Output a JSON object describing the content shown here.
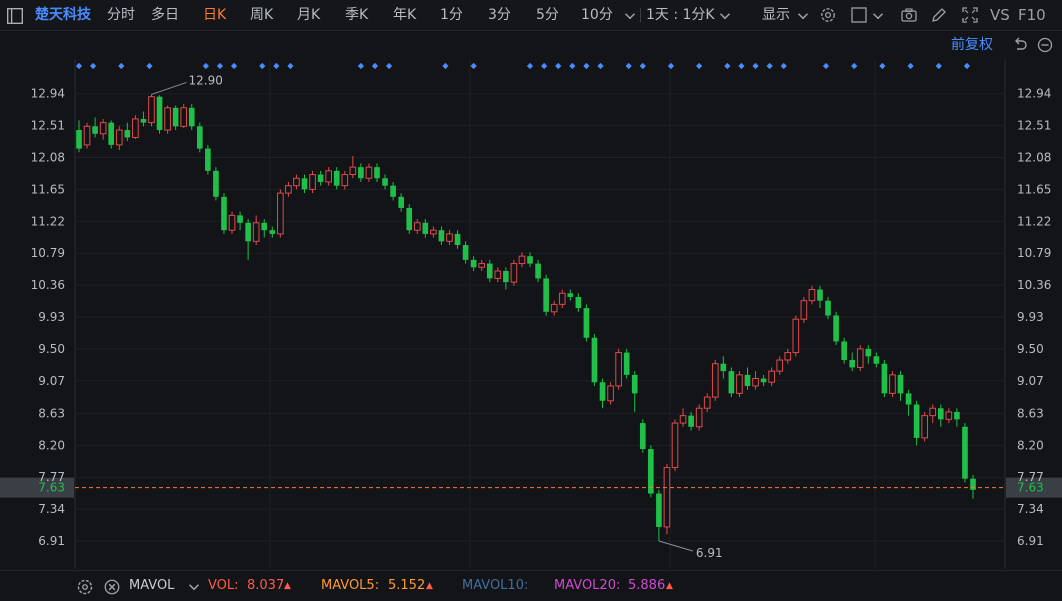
{
  "toolbar": {
    "stock_name": "楚天科技",
    "tabs": [
      {
        "label": "分时"
      },
      {
        "label": "多日"
      },
      {
        "label": "日K",
        "active": true
      },
      {
        "label": "周K"
      },
      {
        "label": "月K"
      },
      {
        "label": "季K"
      },
      {
        "label": "年K"
      },
      {
        "label": "1分"
      },
      {
        "label": "3分"
      },
      {
        "label": "5分"
      },
      {
        "label": "10分"
      }
    ],
    "period_select": "1天 : 1分K",
    "display_label": "显示",
    "vs_label": "VS",
    "f10_label": "F10"
  },
  "sub_toolbar": {
    "adjust_label": "前复权"
  },
  "chart_data": {
    "type": "candlestick",
    "y_ticks": [
      "12.94",
      "12.51",
      "12.08",
      "11.65",
      "11.22",
      "10.79",
      "10.36",
      "9.93",
      "9.50",
      "9.07",
      "8.63",
      "8.20",
      "7.77",
      "7.34",
      "6.91"
    ],
    "ylim": [
      6.6,
      13.3
    ],
    "current_price": "7.63",
    "high_label": "12.90",
    "low_label": "6.91",
    "candles": [
      [
        12.45,
        12.2,
        12.58,
        12.15
      ],
      [
        12.25,
        12.5,
        12.55,
        12.2
      ],
      [
        12.5,
        12.4,
        12.62,
        12.35
      ],
      [
        12.4,
        12.55,
        12.6,
        12.32
      ],
      [
        12.55,
        12.25,
        12.58,
        12.2
      ],
      [
        12.25,
        12.45,
        12.5,
        12.18
      ],
      [
        12.45,
        12.35,
        12.55,
        12.3
      ],
      [
        12.35,
        12.6,
        12.65,
        12.33
      ],
      [
        12.6,
        12.55,
        12.7,
        12.5
      ],
      [
        12.55,
        12.9,
        12.93,
        12.5
      ],
      [
        12.9,
        12.45,
        12.92,
        12.4
      ],
      [
        12.45,
        12.75,
        12.78,
        12.4
      ],
      [
        12.75,
        12.5,
        12.78,
        12.45
      ],
      [
        12.5,
        12.75,
        12.8,
        12.48
      ],
      [
        12.75,
        12.5,
        12.8,
        12.45
      ],
      [
        12.5,
        12.2,
        12.55,
        12.15
      ],
      [
        12.2,
        11.9,
        12.25,
        11.85
      ],
      [
        11.9,
        11.55,
        11.95,
        11.5
      ],
      [
        11.55,
        11.1,
        11.6,
        11.05
      ],
      [
        11.1,
        11.3,
        11.35,
        11.05
      ],
      [
        11.3,
        11.2,
        11.35,
        11.1
      ],
      [
        11.2,
        10.95,
        11.25,
        10.7
      ],
      [
        10.95,
        11.2,
        11.3,
        10.9
      ],
      [
        11.2,
        11.1,
        11.25,
        11.0
      ],
      [
        11.1,
        11.05,
        11.15,
        11.0
      ],
      [
        11.05,
        11.6,
        11.65,
        11.0
      ],
      [
        11.6,
        11.7,
        11.75,
        11.55
      ],
      [
        11.7,
        11.8,
        11.85,
        11.65
      ],
      [
        11.8,
        11.65,
        11.85,
        11.6
      ],
      [
        11.65,
        11.85,
        11.9,
        11.6
      ],
      [
        11.85,
        11.75,
        11.9,
        11.7
      ],
      [
        11.75,
        11.9,
        11.95,
        11.7
      ],
      [
        11.9,
        11.7,
        11.95,
        11.65
      ],
      [
        11.7,
        11.85,
        11.9,
        11.65
      ],
      [
        11.85,
        11.95,
        12.1,
        11.8
      ],
      [
        11.95,
        11.8,
        12.0,
        11.75
      ],
      [
        11.8,
        11.95,
        12.0,
        11.75
      ],
      [
        11.95,
        11.8,
        12.0,
        11.75
      ],
      [
        11.8,
        11.7,
        11.85,
        11.65
      ],
      [
        11.7,
        11.55,
        11.75,
        11.5
      ],
      [
        11.55,
        11.4,
        11.6,
        11.35
      ],
      [
        11.4,
        11.1,
        11.45,
        11.05
      ],
      [
        11.1,
        11.2,
        11.25,
        11.05
      ],
      [
        11.2,
        11.05,
        11.25,
        11.0
      ],
      [
        11.05,
        11.1,
        11.15,
        11.0
      ],
      [
        11.1,
        10.95,
        11.15,
        10.9
      ],
      [
        10.95,
        11.05,
        11.1,
        10.9
      ],
      [
        11.05,
        10.9,
        11.1,
        10.85
      ],
      [
        10.9,
        10.7,
        10.95,
        10.65
      ],
      [
        10.7,
        10.6,
        10.75,
        10.55
      ],
      [
        10.6,
        10.65,
        10.7,
        10.55
      ],
      [
        10.65,
        10.45,
        10.7,
        10.4
      ],
      [
        10.45,
        10.55,
        10.6,
        10.4
      ],
      [
        10.55,
        10.4,
        10.6,
        10.3
      ],
      [
        10.4,
        10.65,
        10.7,
        10.35
      ],
      [
        10.65,
        10.75,
        10.8,
        10.6
      ],
      [
        10.75,
        10.65,
        10.8,
        10.6
      ],
      [
        10.65,
        10.45,
        10.7,
        10.4
      ],
      [
        10.45,
        10.0,
        10.5,
        9.95
      ],
      [
        10.0,
        10.1,
        10.15,
        9.95
      ],
      [
        10.1,
        10.25,
        10.3,
        10.05
      ],
      [
        10.25,
        10.2,
        10.3,
        10.15
      ],
      [
        10.2,
        10.05,
        10.25,
        10.0
      ],
      [
        10.05,
        9.65,
        10.1,
        9.6
      ],
      [
        9.65,
        9.05,
        9.7,
        9.0
      ],
      [
        9.05,
        8.8,
        9.1,
        8.7
      ],
      [
        8.8,
        9.0,
        9.05,
        8.75
      ],
      [
        9.0,
        9.45,
        9.5,
        8.95
      ],
      [
        9.45,
        9.15,
        9.5,
        9.1
      ],
      [
        9.15,
        8.9,
        9.2,
        8.65
      ],
      [
        8.5,
        8.15,
        8.55,
        8.1
      ],
      [
        8.15,
        7.55,
        8.2,
        7.5
      ],
      [
        7.55,
        7.1,
        7.6,
        6.91
      ],
      [
        7.1,
        7.9,
        7.95,
        7.0
      ],
      [
        7.9,
        8.5,
        8.55,
        7.85
      ],
      [
        8.5,
        8.6,
        8.7,
        8.45
      ],
      [
        8.6,
        8.45,
        8.65,
        8.4
      ],
      [
        8.45,
        8.7,
        8.75,
        8.4
      ],
      [
        8.7,
        8.85,
        8.9,
        8.65
      ],
      [
        8.85,
        9.3,
        9.35,
        8.8
      ],
      [
        9.3,
        9.2,
        9.4,
        9.1
      ],
      [
        9.2,
        8.9,
        9.25,
        8.85
      ],
      [
        8.9,
        9.15,
        9.2,
        8.85
      ],
      [
        9.15,
        9.0,
        9.25,
        8.95
      ],
      [
        9.0,
        9.1,
        9.2,
        8.95
      ],
      [
        9.1,
        9.05,
        9.15,
        9.0
      ],
      [
        9.05,
        9.2,
        9.25,
        9.0
      ],
      [
        9.2,
        9.35,
        9.4,
        9.15
      ],
      [
        9.35,
        9.45,
        9.5,
        9.3
      ],
      [
        9.45,
        9.9,
        9.95,
        9.4
      ],
      [
        9.9,
        10.15,
        10.2,
        9.85
      ],
      [
        10.15,
        10.3,
        10.35,
        10.1
      ],
      [
        10.3,
        10.15,
        10.35,
        10.05
      ],
      [
        10.15,
        9.95,
        10.2,
        9.9
      ],
      [
        9.95,
        9.6,
        10.0,
        9.55
      ],
      [
        9.6,
        9.35,
        9.65,
        9.3
      ],
      [
        9.35,
        9.25,
        9.45,
        9.2
      ],
      [
        9.25,
        9.5,
        9.55,
        9.2
      ],
      [
        9.5,
        9.4,
        9.55,
        9.3
      ],
      [
        9.4,
        9.3,
        9.45,
        9.25
      ],
      [
        9.3,
        8.9,
        9.35,
        8.85
      ],
      [
        8.9,
        9.15,
        9.2,
        8.85
      ],
      [
        9.15,
        8.9,
        9.2,
        8.8
      ],
      [
        8.9,
        8.75,
        8.95,
        8.6
      ],
      [
        8.75,
        8.3,
        8.8,
        8.2
      ],
      [
        8.3,
        8.6,
        8.65,
        8.25
      ],
      [
        8.6,
        8.7,
        8.75,
        8.5
      ],
      [
        8.7,
        8.55,
        8.75,
        8.45
      ],
      [
        8.55,
        8.65,
        8.7,
        8.5
      ],
      [
        8.65,
        8.55,
        8.7,
        8.45
      ],
      [
        8.45,
        7.75,
        8.5,
        7.7
      ],
      [
        7.75,
        7.6,
        7.8,
        7.48
      ]
    ],
    "event_dot_indices": [
      0,
      1,
      3,
      5,
      9,
      10,
      11,
      13,
      14,
      15,
      20,
      21,
      22,
      26,
      28,
      32,
      33,
      34,
      35,
      36,
      37,
      39,
      40,
      42,
      44,
      46,
      47,
      48,
      49,
      50,
      53,
      55,
      57,
      59,
      61,
      63
    ],
    "indicator": {
      "name": "MAVOL",
      "vol_label": "VOL:",
      "vol_value": "8.037",
      "mavol5_label": "MAVOL5:",
      "mavol5_value": "5.152",
      "mavol10_label": "MAVOL10:",
      "mavol20_label": "MAVOL20:",
      "mavol20_value": "5.886"
    }
  },
  "colors": {
    "up": "#e04a4a",
    "down": "#1fbf4a",
    "accent": "#ff7a2a",
    "brand": "#4a8cff",
    "vol": "#ff5a4a",
    "mavol5": "#ff9a30",
    "mavol10": "#4a86c8",
    "mavol20": "#d04ad0"
  }
}
